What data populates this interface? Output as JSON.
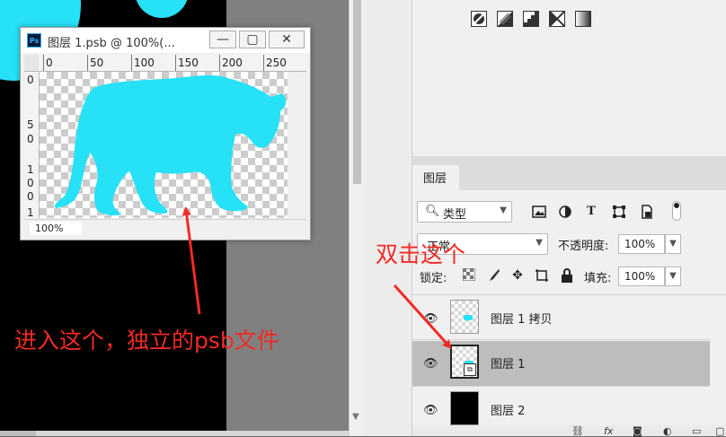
{
  "document": {
    "title": "图层 1.psb @ 100%(...",
    "app_badge": "Ps",
    "window_buttons": {
      "minimize": "—",
      "maximize": "▢",
      "close": "✕"
    },
    "ruler_h_ticks": [
      "0",
      "50",
      "100",
      "150",
      "200",
      "250"
    ],
    "ruler_v_ticks": [
      "0",
      "5",
      "0",
      "1",
      "0",
      "0",
      "1"
    ],
    "zoom": "100%"
  },
  "annotations": {
    "left_text": "进入这个，独立的psb文件",
    "right_text": "双击这个",
    "color": "#f12b25"
  },
  "layers_panel": {
    "tab_label": "图层",
    "filter": {
      "icon": "search-icon",
      "label": "类型"
    },
    "blend_mode": "正常",
    "opacity_label": "不透明度:",
    "opacity_value": "100%",
    "lock_label": "锁定:",
    "fill_label": "填充:",
    "fill_value": "100%",
    "layers": [
      {
        "name": "图层 1 拷贝",
        "selected": false,
        "thumb": "transparent"
      },
      {
        "name": "图层 1",
        "selected": true,
        "thumb": "smart-object"
      },
      {
        "name": "图层 2",
        "selected": false,
        "thumb": "black"
      }
    ],
    "footer_icons": [
      "link-icon",
      "fx-icon",
      "mask-icon",
      "adjustment-icon",
      "folder-icon",
      "new-layer-icon"
    ]
  },
  "colors": {
    "subject_cyan": "#27e1f6",
    "selected_row": "#bdbdbd"
  }
}
